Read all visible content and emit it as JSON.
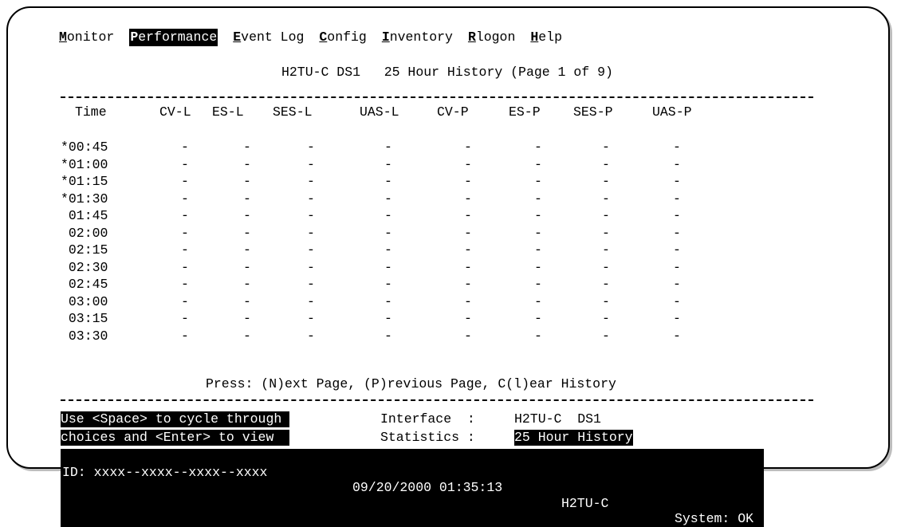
{
  "menu": [
    {
      "hot": "M",
      "rest": "onitor",
      "active": false
    },
    {
      "hot": "P",
      "rest": "erformance",
      "active": true
    },
    {
      "hot": "E",
      "rest": "vent Log",
      "active": false
    },
    {
      "hot": "C",
      "rest": "onfig",
      "active": false
    },
    {
      "hot": "I",
      "rest": "nventory",
      "active": false
    },
    {
      "hot": "R",
      "rest": "logon",
      "active": false
    },
    {
      "hot": "H",
      "rest": "elp",
      "active": false
    }
  ],
  "title": "H2TU-C DS1   25 Hour History (Page 1 of 9)",
  "columns": [
    "Time",
    "CV-L",
    "ES-L",
    "SES-L",
    "UAS-L",
    "CV-P",
    "ES-P",
    "SES-P",
    "UAS-P"
  ],
  "rows": [
    {
      "time": "*00:45",
      "values": [
        "-",
        "-",
        "-",
        "-",
        "-",
        "-",
        "-",
        "-"
      ]
    },
    {
      "time": "*01:00",
      "values": [
        "-",
        "-",
        "-",
        "-",
        "-",
        "-",
        "-",
        "-"
      ]
    },
    {
      "time": "*01:15",
      "values": [
        "-",
        "-",
        "-",
        "-",
        "-",
        "-",
        "-",
        "-"
      ]
    },
    {
      "time": "*01:30",
      "values": [
        "-",
        "-",
        "-",
        "-",
        "-",
        "-",
        "-",
        "-"
      ]
    },
    {
      "time": " 01:45",
      "values": [
        "-",
        "-",
        "-",
        "-",
        "-",
        "-",
        "-",
        "-"
      ]
    },
    {
      "time": " 02:00",
      "values": [
        "-",
        "-",
        "-",
        "-",
        "-",
        "-",
        "-",
        "-"
      ]
    },
    {
      "time": " 02:15",
      "values": [
        "-",
        "-",
        "-",
        "-",
        "-",
        "-",
        "-",
        "-"
      ]
    },
    {
      "time": " 02:30",
      "values": [
        "-",
        "-",
        "-",
        "-",
        "-",
        "-",
        "-",
        "-"
      ]
    },
    {
      "time": " 02:45",
      "values": [
        "-",
        "-",
        "-",
        "-",
        "-",
        "-",
        "-",
        "-"
      ]
    },
    {
      "time": " 03:00",
      "values": [
        "-",
        "-",
        "-",
        "-",
        "-",
        "-",
        "-",
        "-"
      ]
    },
    {
      "time": " 03:15",
      "values": [
        "-",
        "-",
        "-",
        "-",
        "-",
        "-",
        "-",
        "-"
      ]
    },
    {
      "time": " 03:30",
      "values": [
        "-",
        "-",
        "-",
        "-",
        "-",
        "-",
        "-",
        "-"
      ]
    }
  ],
  "press_prompt": "Press: (N)ext Page, (P)revious Page, C(l)ear History",
  "help": {
    "line1": "Use <Space> to cycle through ",
    "line2": "choices and <Enter> to view  "
  },
  "interface": {
    "label": "Interface  :",
    "value": "H2TU-C  DS1"
  },
  "statistics": {
    "label": "Statistics :",
    "value": "25 Hour History"
  },
  "status_bar": {
    "id": "ID: xxxx--xxxx--xxxx--xxxx",
    "datetime": "09/20/2000 01:35:13",
    "unit": "H2TU-C",
    "system": "System: OK"
  },
  "colors": {
    "background": "#ffffff",
    "text": "#000000",
    "highlight": "#000000"
  }
}
